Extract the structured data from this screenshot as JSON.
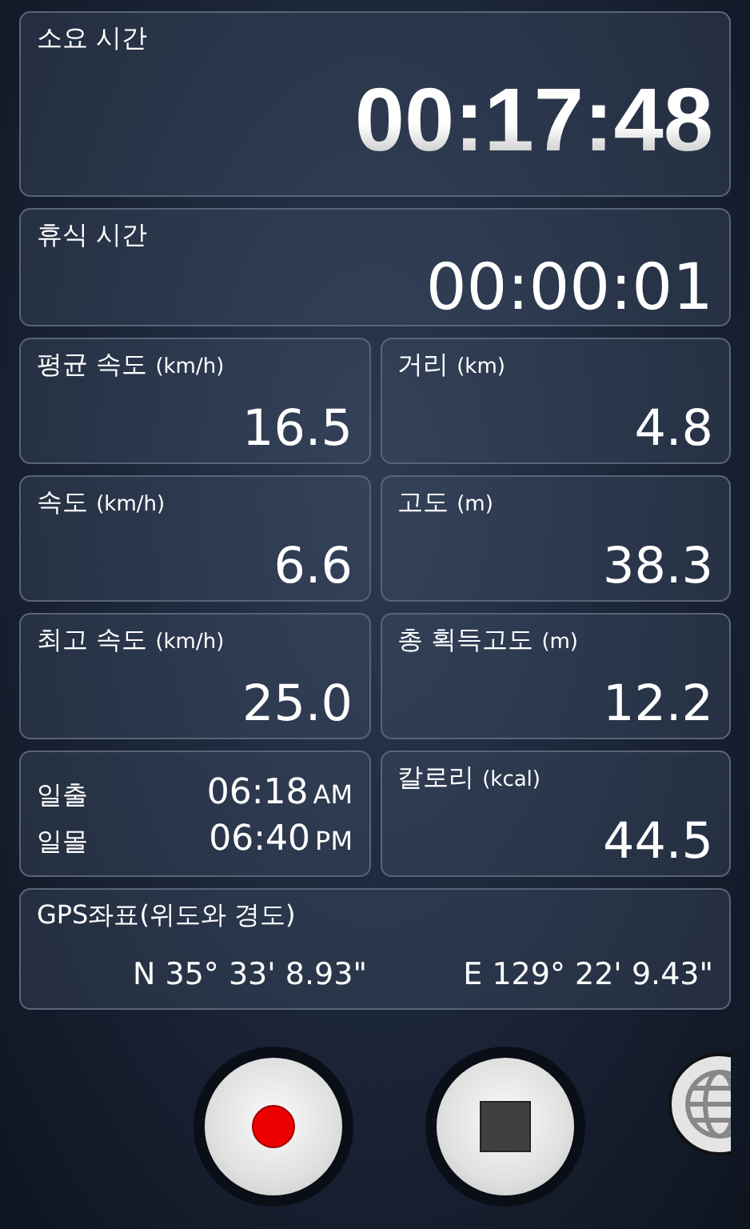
{
  "elapsed": {
    "label": "소요 시간",
    "value": "00:17:48"
  },
  "rest": {
    "label": "휴식 시간",
    "value": "00:00:01"
  },
  "cells": [
    {
      "kind": "stat",
      "label": "평균 속도",
      "unit": "(km/h)",
      "value": "16.5"
    },
    {
      "kind": "stat",
      "label": "거리",
      "unit": "(km)",
      "value": "4.8"
    },
    {
      "kind": "stat",
      "label": "속도",
      "unit": "(km/h)",
      "value": "6.6"
    },
    {
      "kind": "stat",
      "label": "고도",
      "unit": "(m)",
      "value": "38.3"
    },
    {
      "kind": "stat",
      "label": "최고 속도",
      "unit": "(km/h)",
      "value": "25.0"
    },
    {
      "kind": "stat",
      "label": "총 획득고도",
      "unit": "(m)",
      "value": "12.2"
    },
    {
      "kind": "sun",
      "rows": [
        {
          "label": "일출",
          "time": "06:18",
          "ampm": "AM"
        },
        {
          "label": "일몰",
          "time": "06:40",
          "ampm": "PM"
        }
      ]
    },
    {
      "kind": "stat",
      "label": "칼로리",
      "unit": "(kcal)",
      "value": "44.5"
    }
  ],
  "gps": {
    "label": "GPS좌표(위도와 경도)",
    "latitude": "N 35° 33' 8.93\"",
    "longitude": "E 129° 22' 9.43\""
  },
  "controls": [
    {
      "kind": "record"
    },
    {
      "kind": "stop"
    },
    {
      "kind": "globe"
    }
  ]
}
